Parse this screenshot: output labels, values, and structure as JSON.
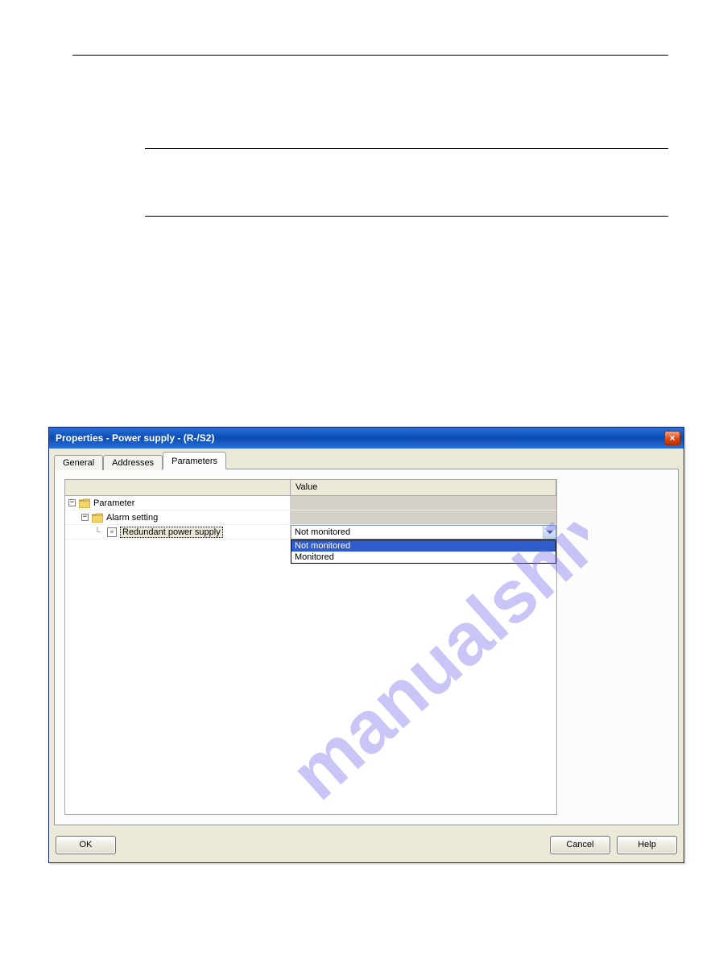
{
  "window": {
    "title": "Properties - Power supply - (R-/S2)",
    "close_label": "×"
  },
  "tabs": {
    "general": "General",
    "addresses": "Addresses",
    "parameters": "Parameters"
  },
  "grid": {
    "header_left": "",
    "header_right": "Value",
    "root": "Parameter",
    "group": "Alarm setting",
    "leaf": "Redundant power supply",
    "current_value": "Not monitored",
    "options": [
      "Not monitored",
      "Monitored"
    ],
    "highlight_index": 0
  },
  "buttons": {
    "ok": "OK",
    "cancel": "Cancel",
    "help": "Help"
  },
  "watermark": "manualshive.com",
  "expander": "−",
  "param_glyph": "≡"
}
